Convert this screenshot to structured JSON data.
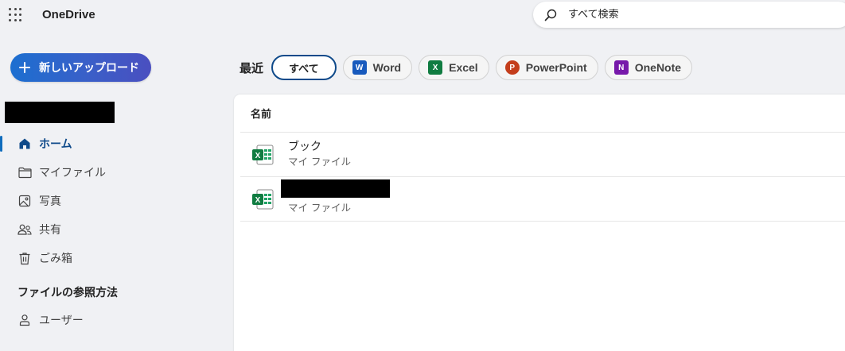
{
  "app": {
    "title": "OneDrive"
  },
  "search": {
    "placeholder": "すべて検索"
  },
  "sidebar": {
    "new_upload_label": "新しいアップロード",
    "items": [
      {
        "label": "ホーム",
        "icon": "home-icon",
        "active": true
      },
      {
        "label": "マイファイル",
        "icon": "folder-icon"
      },
      {
        "label": "写真",
        "icon": "photo-icon"
      },
      {
        "label": "共有",
        "icon": "people-icon"
      },
      {
        "label": "ごみ箱",
        "icon": "trash-icon"
      }
    ],
    "section_title": "ファイルの参照方法",
    "section_items": [
      {
        "label": "ユーザー",
        "icon": "person-icon"
      }
    ]
  },
  "filters": {
    "label": "最近",
    "pills": [
      {
        "label": "すべて",
        "selected": true
      },
      {
        "label": "Word",
        "icon": "word-icon",
        "color": "#185abd"
      },
      {
        "label": "Excel",
        "icon": "excel-icon",
        "color": "#107c41"
      },
      {
        "label": "PowerPoint",
        "icon": "powerpoint-icon",
        "color": "#c43e1c"
      },
      {
        "label": "OneNote",
        "icon": "onenote-icon",
        "color": "#7719aa"
      }
    ]
  },
  "list": {
    "column_name": "名前",
    "rows": [
      {
        "name": "ブック",
        "location": "マイ ファイル",
        "icon": "excel-file-icon"
      },
      {
        "name": "",
        "location": "マイ ファイル",
        "icon": "excel-file-icon",
        "name_redacted": true
      }
    ]
  },
  "colors": {
    "accent": "#0f6cbd",
    "active_nav": "#0f4a8a",
    "excel_green": "#107c41"
  }
}
